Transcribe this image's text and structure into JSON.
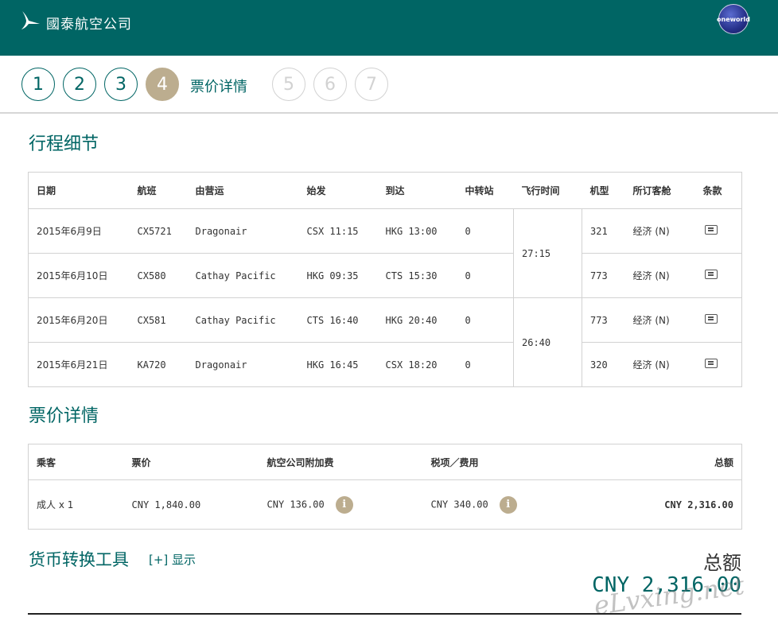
{
  "header": {
    "brand": "國泰航空公司",
    "partner": "oneworld"
  },
  "steps": {
    "items": [
      "1",
      "2",
      "3",
      "4",
      "5",
      "6",
      "7"
    ],
    "current": "4",
    "current_label": "票价详情"
  },
  "itinerary": {
    "title": "行程细节",
    "columns": [
      "日期",
      "航班",
      "由营运",
      "始发",
      "到达",
      "中转站",
      "飞行时间",
      "机型",
      "所订客舱",
      "条款"
    ],
    "rows": [
      {
        "date": "2015年6月9日",
        "flight": "CX5721",
        "operator": "Dragonair",
        "depart": "CSX 11:15",
        "arrive": "HKG 13:00",
        "stops": "0",
        "aircraft": "321",
        "cabin": "经济 (N)"
      },
      {
        "date": "2015年6月10日",
        "flight": "CX580",
        "operator": "Cathay Pacific",
        "depart": "HKG 09:35",
        "arrive": "CTS 15:30",
        "stops": "0",
        "aircraft": "773",
        "cabin": "经济 (N)"
      },
      {
        "date": "2015年6月20日",
        "flight": "CX581",
        "operator": "Cathay Pacific",
        "depart": "CTS 16:40",
        "arrive": "HKG 20:40",
        "stops": "0",
        "aircraft": "773",
        "cabin": "经济 (N)"
      },
      {
        "date": "2015年6月21日",
        "flight": "KA720",
        "operator": "Dragonair",
        "depart": "HKG 16:45",
        "arrive": "CSX 18:20",
        "stops": "0",
        "aircraft": "320",
        "cabin": "经济 (N)"
      }
    ],
    "durations": [
      "27:15",
      "26:40"
    ]
  },
  "fare": {
    "title": "票价详情",
    "columns": [
      "乘客",
      "票价",
      "航空公司附加费",
      "税项／费用",
      "总额"
    ],
    "row": {
      "passenger": "成人 x 1",
      "fare": "CNY 1,840.00",
      "surcharge": "CNY 136.00",
      "tax": "CNY 340.00",
      "total": "CNY 2,316.00"
    }
  },
  "converter": {
    "title": "货币转换工具",
    "toggle": "[+] 显示"
  },
  "total": {
    "label": "总额",
    "value": "CNY 2,316.00"
  },
  "watermark": "eLvxing.net",
  "icons": {
    "info": "info-icon",
    "terms": "document-icon",
    "logo": "bird-logo-icon"
  }
}
